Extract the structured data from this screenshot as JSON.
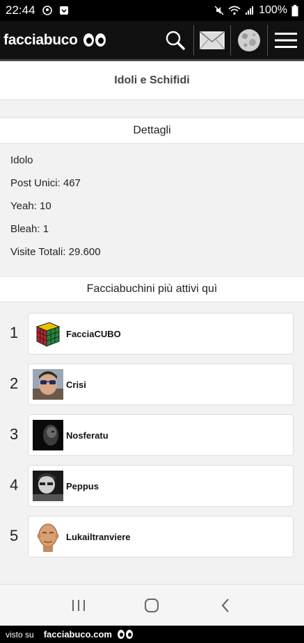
{
  "status_bar": {
    "time": "22:44",
    "battery": "100%",
    "icons": [
      "notification-icon",
      "download-icon",
      "mute-icon",
      "wifi-icon",
      "signal-icon",
      "battery-icon"
    ]
  },
  "app_bar": {
    "brand": "facciabuco",
    "icons": [
      "search-icon",
      "mail-icon",
      "moon-icon",
      "menu-icon"
    ]
  },
  "page": {
    "title": "Idoli e Schifidi"
  },
  "details": {
    "header": "Dettagli",
    "type": "Idolo",
    "post_unici": "Post Unici: 467",
    "yeah": "Yeah: 10",
    "bleah": "Bleah: 1",
    "visite": "Visite Totali: 29.600"
  },
  "ranking": {
    "header": "Facciabuchini più attivi quì",
    "items": [
      {
        "rank": "1",
        "name": "FacciaCUBO"
      },
      {
        "rank": "2",
        "name": "Crisi"
      },
      {
        "rank": "3",
        "name": "Nosferatu"
      },
      {
        "rank": "4",
        "name": "Peppus"
      },
      {
        "rank": "5",
        "name": "Lukailtranviere"
      }
    ]
  },
  "nav_bar": {
    "icons": [
      "recent-apps-icon",
      "home-icon",
      "back-icon"
    ]
  },
  "footer": {
    "prefix": "visto su",
    "site": "facciabuco.com"
  }
}
